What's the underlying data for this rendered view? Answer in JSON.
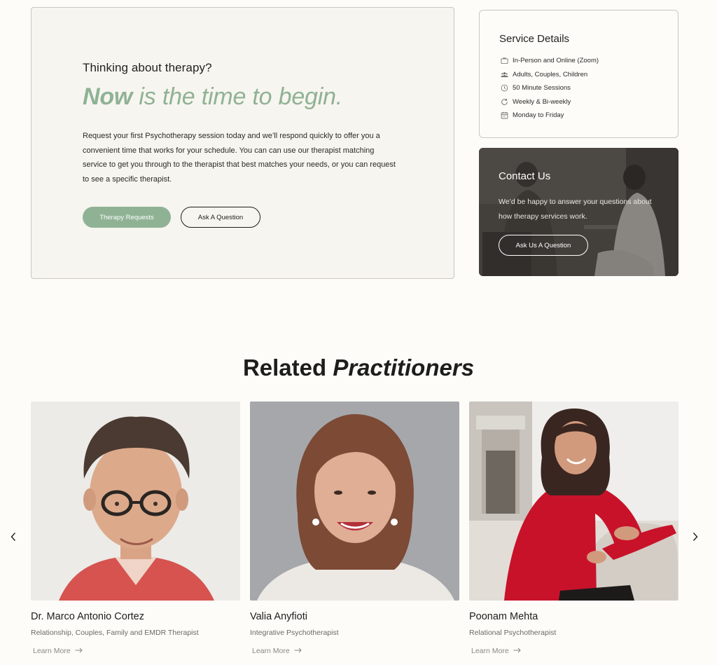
{
  "hero": {
    "eyebrow": "Thinking about therapy?",
    "headline_strong": "Now",
    "headline_rest": " is the time to begin.",
    "body": "Request your first Psychotherapy session today and we’ll respond quickly to offer you a convenient time that works for your schedule. You can can use our therapist matching service to get you through to the therapist that best matches your needs, or you can request to see a specific therapist.",
    "primary_button": "Therapy Requests",
    "secondary_button": "Ask A Question"
  },
  "service_details": {
    "title": "Service Details",
    "items": [
      {
        "icon": "briefcase-icon",
        "label": "In-Person and Online (Zoom)"
      },
      {
        "icon": "users-icon",
        "label": "Adults, Couples, Children"
      },
      {
        "icon": "clock-icon",
        "label": "50 Minute Sessions"
      },
      {
        "icon": "refresh-icon",
        "label": "Weekly & Bi-weekly"
      },
      {
        "icon": "calendar-icon",
        "label": "Monday to Friday"
      }
    ]
  },
  "contact": {
    "title": "Contact Us",
    "text": "We’d be happy to answer your questions about how therapy services work.",
    "button": "Ask Us A Question"
  },
  "practitioners": {
    "title_plain": "Related ",
    "title_em": "Practitioners",
    "cards": [
      {
        "name": "Dr. Marco Antonio Cortez",
        "role": "Relationship, Couples, Family and EMDR Therapist",
        "link": "Learn More"
      },
      {
        "name": "Valia Anyfioti",
        "role": "Integrative Psychotherapist",
        "link": "Learn More"
      },
      {
        "name": "Poonam Mehta",
        "role": "Relational Psychotherapist",
        "link": "Learn More"
      }
    ]
  },
  "colors": {
    "accent_green": "#8fb295",
    "background": "#fdfcf8",
    "hero_card_bg": "#f7f5ef",
    "text_dark": "#1d1d1b"
  }
}
